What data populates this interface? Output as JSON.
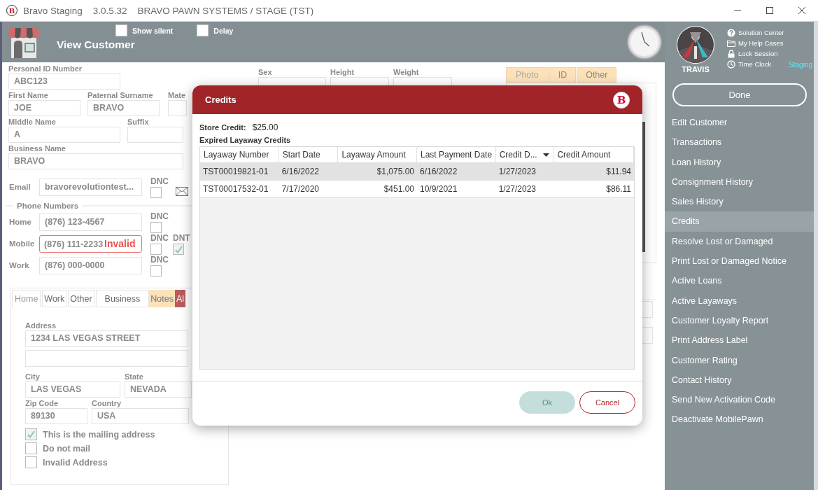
{
  "title_bar": {
    "logo": "B",
    "app_name": "Bravo Staging",
    "version": "3.0.5.32",
    "context": "BRAVO PAWN SYSTEMS / STAGE (TST)"
  },
  "header": {
    "title": "View Customer",
    "options": [
      {
        "label": "Show silent",
        "checked": false
      },
      {
        "label": "Delay",
        "checked": false
      }
    ]
  },
  "identity_rows": [
    [
      {
        "label": "Personal ID Number",
        "value": "ABC123"
      }
    ],
    [
      {
        "label": "First Name",
        "value": "JOE"
      },
      {
        "label": "Paternal Surname",
        "value": "BRAVO"
      },
      {
        "label": "Mate"
      }
    ],
    [
      {
        "label": "Middle Name",
        "value": "A"
      },
      {
        "label": "Suffix"
      }
    ],
    [
      {
        "label": "Business Name",
        "value": "BRAVO"
      }
    ]
  ],
  "email": {
    "label": "Email",
    "value": "bravorevolutiontest...",
    "dnc_label": "DNC",
    "dnc": false
  },
  "phone_numbers": {
    "legend": "Phone Numbers",
    "phones": [
      {
        "label": "Home",
        "value": "(876) 123-4567",
        "invalid": false,
        "dnc_label": "DNC",
        "dnc": false
      },
      {
        "label": "Mobile",
        "value": "(876) 111-2233",
        "invalid": true,
        "error": "Invalid",
        "dnc_label": "DNC",
        "dnc": false,
        "dnt_label": "DNT",
        "dnt": true
      },
      {
        "label": "Work",
        "value": "(876) 000-0000",
        "invalid": false,
        "dnc_label": "DNC",
        "dnc": false
      }
    ]
  },
  "address_panel": {
    "tabs": [
      {
        "label": "Home",
        "selected": true
      },
      {
        "label": "Work",
        "selected": false
      },
      {
        "label": "Other",
        "selected": false
      },
      {
        "label": "Business",
        "selected": false
      },
      {
        "label": "Notes",
        "selected": false,
        "color": "#fde1b9"
      },
      {
        "label": "Al",
        "selected": false,
        "color": "#b85c5e"
      }
    ],
    "address_label": "Address",
    "address_line": "1234 LAS VEGAS STREET",
    "city": {
      "label": "City",
      "value": "LAS VEGAS"
    },
    "state": {
      "label": "State",
      "value": "NEVADA"
    },
    "zip": {
      "label": "Zip Code",
      "value": "89130"
    },
    "country": {
      "label": "Country",
      "value": "USA"
    },
    "options": [
      {
        "label": "This is the mailing address",
        "checked": true
      },
      {
        "label": "Do not mail",
        "checked": false
      },
      {
        "label": "Invalid Address",
        "checked": false
      }
    ]
  },
  "vitals": [
    {
      "label": "Sex"
    },
    {
      "label": "Height"
    },
    {
      "label": "Weight"
    }
  ],
  "media_tabs": [
    {
      "label": "Photo",
      "selected": true
    },
    {
      "label": "ID",
      "selected": false
    },
    {
      "label": "Other",
      "selected": false
    }
  ],
  "sidebar": {
    "user": "TRAVIS",
    "links": [
      {
        "kind": "help",
        "label": "Solution Center"
      },
      {
        "kind": "folder",
        "label": "My Help Cases"
      },
      {
        "kind": "lock",
        "label": "Lock Session"
      },
      {
        "kind": "clock",
        "label": "Time Clock"
      }
    ],
    "environment": "Staging",
    "done_button": "Done",
    "menu": [
      {
        "label": "Edit Customer",
        "selected": false
      },
      {
        "label": "Transactions",
        "selected": false
      },
      {
        "label": "Loan History",
        "selected": false
      },
      {
        "label": "Consignment History",
        "selected": false
      },
      {
        "label": "Sales History",
        "selected": false
      },
      {
        "label": "Credits",
        "selected": true
      },
      {
        "label": "Resolve Lost or Damaged",
        "selected": false
      },
      {
        "label": "Print Lost or Damaged Notice",
        "selected": false
      },
      {
        "label": "Active Loans",
        "selected": false
      },
      {
        "label": "Active Layaways",
        "selected": false
      },
      {
        "label": "Customer Loyalty Report",
        "selected": false
      },
      {
        "label": "Print Address Label",
        "selected": false
      },
      {
        "label": "Customer Rating",
        "selected": false
      },
      {
        "label": "Contact History",
        "selected": false
      },
      {
        "label": "Send New Activation Code",
        "selected": false
      },
      {
        "label": "Deactivate MobilePawn",
        "selected": false
      }
    ]
  },
  "credits_dialog": {
    "title": "Credits",
    "logo": "B",
    "store_credit_label": "Store Credit:",
    "store_credit": "$25.00",
    "section_title": "Expired Layaway Credits",
    "columns": [
      {
        "label": "Layaway Number",
        "kind": "text",
        "sorted_descending": false
      },
      {
        "label": "Start Date",
        "kind": "text",
        "sorted_descending": false
      },
      {
        "label": "Layaway Amount",
        "kind": "amount",
        "sorted_descending": false
      },
      {
        "label": "Last Payment Date",
        "kind": "text",
        "sorted_descending": false
      },
      {
        "label": "Credit D...",
        "kind": "text",
        "sorted_descending": true
      },
      {
        "label": "Credit Amount",
        "kind": "amount",
        "sorted_descending": false
      }
    ],
    "rows": [
      {
        "selected": true,
        "cells": [
          "TST00019821-01",
          "6/16/2022",
          "$1,075.00",
          "6/16/2022",
          "1/27/2023",
          "$11.94"
        ]
      },
      {
        "selected": false,
        "cells": [
          "TST00017532-01",
          "7/17/2020",
          "$451.00",
          "10/9/2021",
          "1/27/2023",
          "$86.11"
        ]
      }
    ],
    "buttons": [
      {
        "label": "Ok",
        "kind": "primary",
        "disabled": true
      },
      {
        "label": "Cancel",
        "kind": "secondary",
        "disabled": false
      }
    ]
  }
}
